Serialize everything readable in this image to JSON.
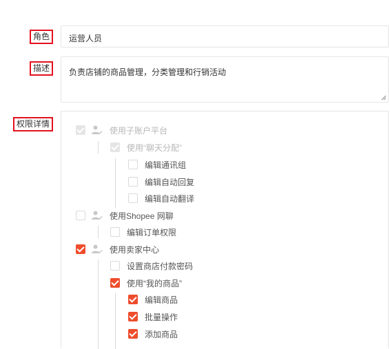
{
  "role": {
    "label": "角色",
    "value": "运营人员"
  },
  "description": {
    "label": "描述",
    "value": "负责店铺的商品管理，分类管理和行销活动"
  },
  "permissions": {
    "label": "权限详情",
    "tree": [
      {
        "key": "sub_account_platform",
        "label": "使用子账户平台",
        "state": "disabled-checked",
        "icon": "user-check-icon"
      },
      {
        "key": "chat_allocation",
        "label": "使用“聊天分配”",
        "state": "disabled-checked"
      },
      {
        "key": "edit_chat_group",
        "label": "编辑通讯组",
        "state": "disabled"
      },
      {
        "key": "edit_auto_reply",
        "label": "编辑自动回复",
        "state": "disabled"
      },
      {
        "key": "edit_auto_translate",
        "label": "编辑自动翻译",
        "state": "disabled"
      },
      {
        "key": "shopee_chat",
        "label": "使用Shopee 网聊",
        "state": "unchecked",
        "icon": "user-check-icon"
      },
      {
        "key": "edit_order_perms",
        "label": "编辑订单权限",
        "state": "unchecked"
      },
      {
        "key": "seller_centre",
        "label": "使用卖家中心",
        "state": "checked",
        "icon": "user-check-icon"
      },
      {
        "key": "set_shop_payment_pwd",
        "label": "设置商店付款密码",
        "state": "unchecked"
      },
      {
        "key": "my_products",
        "label": "使用“我的商品”",
        "state": "checked"
      },
      {
        "key": "edit_products",
        "label": "编辑商品",
        "state": "checked"
      },
      {
        "key": "batch_ops",
        "label": "批量操作",
        "state": "checked"
      },
      {
        "key": "add_products",
        "label": "添加商品",
        "state": "checked"
      }
    ]
  },
  "colors": {
    "accent": "#ee4d2d",
    "highlight_box": "#e3101d",
    "border": "#e5e5e5"
  }
}
